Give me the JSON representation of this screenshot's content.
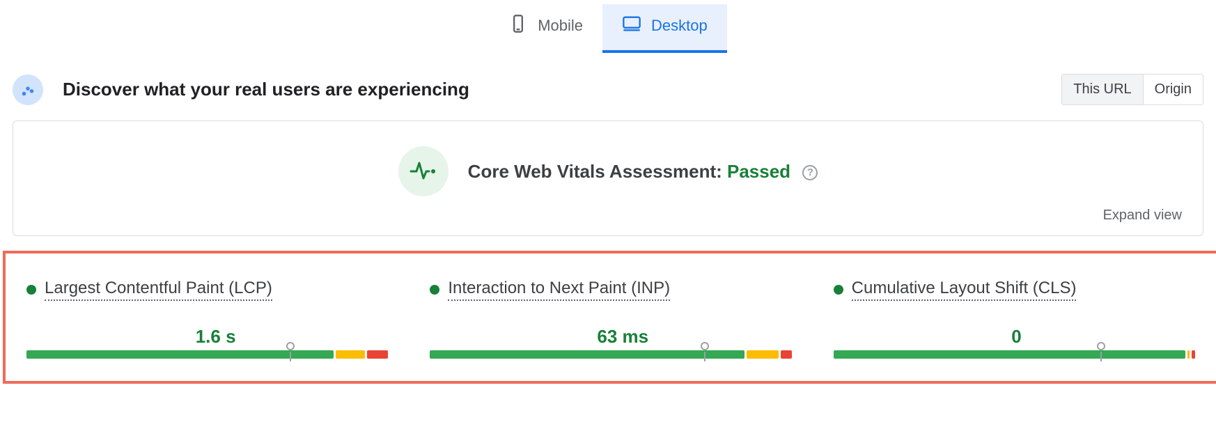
{
  "tabs": {
    "mobile": "Mobile",
    "desktop": "Desktop"
  },
  "heading": {
    "title": "Discover what your real users are experiencing"
  },
  "scope": {
    "this_url": "This URL",
    "origin": "Origin"
  },
  "assessment": {
    "label": "Core Web Vitals Assessment: ",
    "status": "Passed"
  },
  "expand_view": "Expand view",
  "metrics": [
    {
      "name": "Largest Contentful Paint (LCP)",
      "value": "1.6 s",
      "marker_pct": 73,
      "segments": [
        {
          "color": "green",
          "pct": 86
        },
        {
          "color": "orange",
          "pct": 8
        },
        {
          "color": "red",
          "pct": 6
        }
      ]
    },
    {
      "name": "Interaction to Next Paint (INP)",
      "value": "63 ms",
      "marker_pct": 76,
      "segments": [
        {
          "color": "green",
          "pct": 88
        },
        {
          "color": "orange",
          "pct": 9
        },
        {
          "color": "red",
          "pct": 3
        }
      ]
    },
    {
      "name": "Cumulative Layout Shift (CLS)",
      "value": "0",
      "marker_pct": 74,
      "segments": [
        {
          "color": "green",
          "pct": 98.5
        },
        {
          "color": "orange",
          "pct": 0.5
        },
        {
          "color": "red",
          "pct": 1
        }
      ]
    }
  ]
}
